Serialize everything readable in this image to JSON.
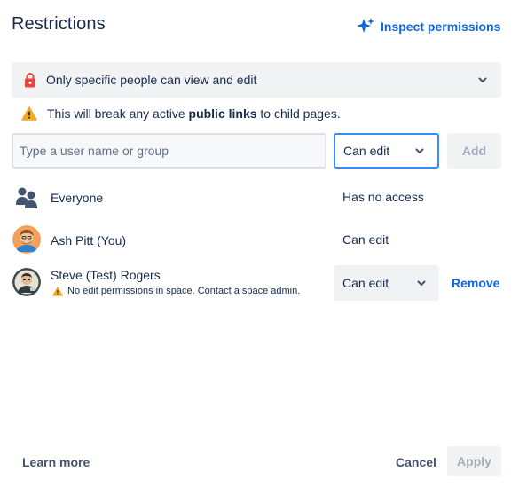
{
  "header": {
    "title": "Restrictions",
    "inspect_label": "Inspect permissions"
  },
  "restriction_select": {
    "value": "Only specific people can view and edit"
  },
  "warning": {
    "prefix": "This will break any active ",
    "bold": "public links",
    "suffix": " to child pages."
  },
  "add_row": {
    "input_placeholder": "Type a user name or group",
    "input_value": "",
    "permission_value": "Can edit",
    "add_label": "Add"
  },
  "members": [
    {
      "name": "Everyone",
      "access": "Has no access"
    },
    {
      "name": "Ash Pitt (You)",
      "access": "Can edit"
    },
    {
      "name": "Steve (Test) Rogers",
      "access": "Can edit",
      "remove_label": "Remove",
      "warning_text": "No edit permissions in space. Contact a ",
      "warning_link": "space admin",
      "warning_end": "."
    }
  ],
  "footer": {
    "learn_more": "Learn more",
    "cancel": "Cancel",
    "apply": "Apply"
  },
  "colors": {
    "link": "#0c66e4",
    "lock": "#e2483d",
    "warning": "#f5a623",
    "focus": "#388bff",
    "text": "#172b4d",
    "subtle": "#44546f",
    "disabled": "#a5adba"
  },
  "icons": {
    "inspect": "sparkle-icon",
    "lock": "lock-icon",
    "warning": "warning-icon",
    "group": "people-group-icon",
    "chevron": "chevron-down-icon"
  }
}
